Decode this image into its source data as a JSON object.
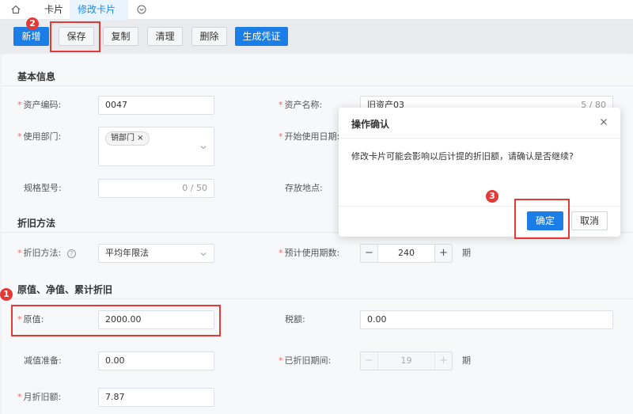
{
  "tabs": {
    "home_icon": "home-icon",
    "items": [
      {
        "label": "卡片"
      },
      {
        "label": "修改卡片"
      }
    ],
    "close_glyph": "×",
    "more_icon": "chevron-circle-icon"
  },
  "toolbar": {
    "new_label": "新增",
    "save_label": "保存",
    "copy_label": "复制",
    "clear_label": "清理",
    "delete_label": "删除",
    "voucher_label": "生成凭证"
  },
  "sections": {
    "basic": "基本信息",
    "depreciation": "折旧方法",
    "values": "原值、净值、累计折旧"
  },
  "basic": {
    "asset_code_label": "资产编码:",
    "asset_code_value": "0047",
    "asset_name_label": "资产名称:",
    "asset_name_value": "旧资产03",
    "asset_name_counter": "5 / 80",
    "dept_label": "使用部门:",
    "dept_tag": "销部门",
    "start_date_label": "开始使用日期:",
    "spec_label": "规格型号:",
    "spec_counter": "0 / 50",
    "location_label": "存放地点:"
  },
  "depreciation": {
    "method_label": "折旧方法:",
    "method_value": "平均年限法",
    "periods_label": "预计使用期数:",
    "periods_value": "240",
    "periods_unit": "期",
    "minus": "−",
    "plus": "+"
  },
  "values": {
    "original_label": "原值:",
    "original_value": "2000.00",
    "tax_label": "税额:",
    "tax_value": "0.00",
    "impairment_label": "减值准备:",
    "impairment_value": "0.00",
    "depreciated_periods_label": "已折旧期间:",
    "depreciated_periods_value": "19",
    "depreciated_periods_unit": "期",
    "monthly_label": "月折旧额:",
    "monthly_value": "7.87"
  },
  "dialog": {
    "title": "操作确认",
    "message": "修改卡片可能会影响以后计提的折旧额，请确认是否继续?",
    "confirm_label": "确定",
    "cancel_label": "取消"
  },
  "annotations": {
    "one": "1",
    "two": "2",
    "three": "3"
  },
  "colors": {
    "primary": "#1a7ee6",
    "annotation": "#e53935",
    "required": "#f56c6c"
  }
}
